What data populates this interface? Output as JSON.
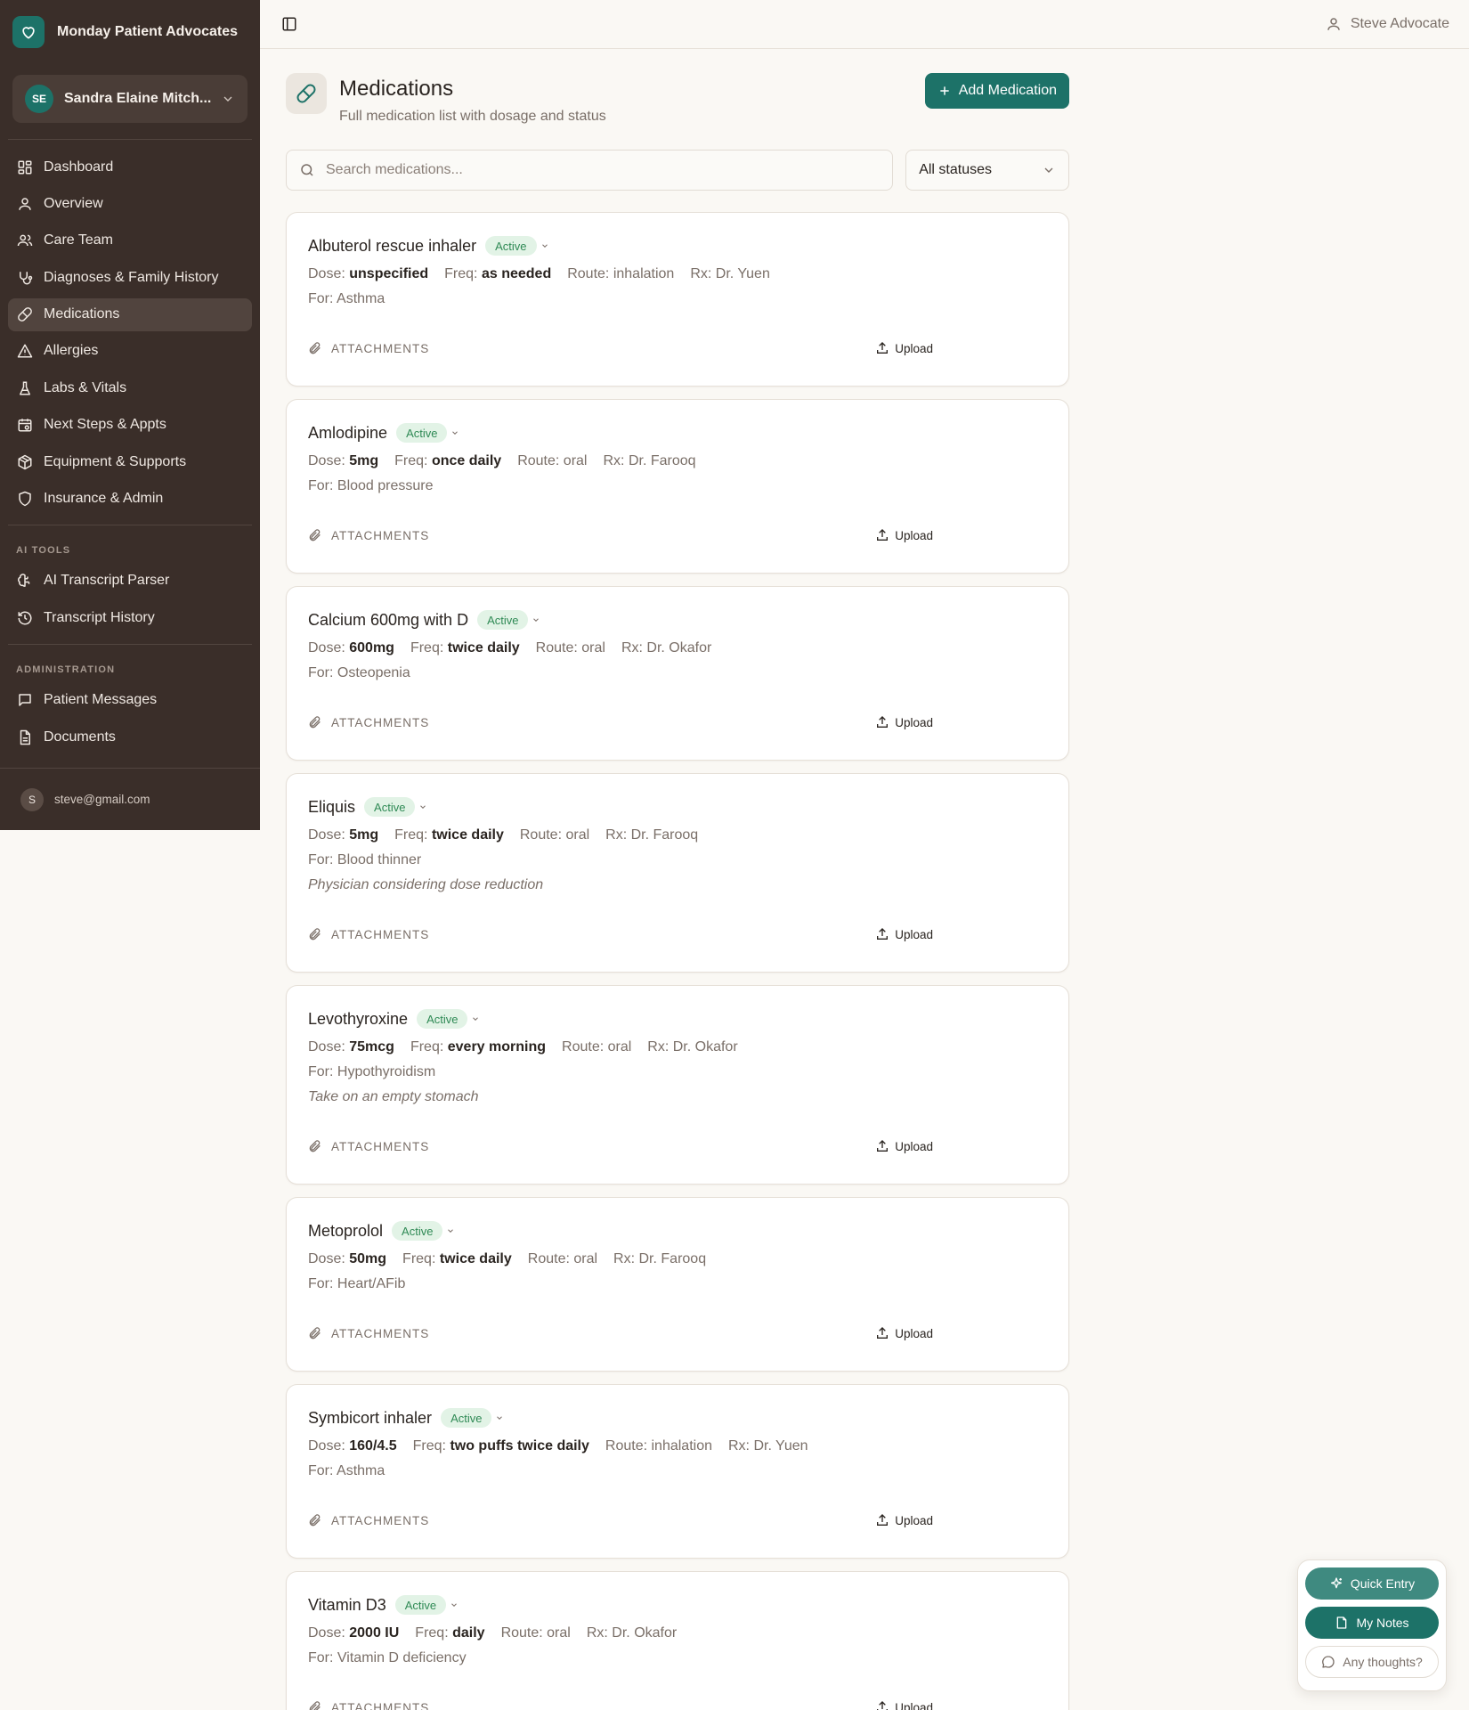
{
  "brand": {
    "name": "Monday Patient Advocates"
  },
  "patient": {
    "initials": "SE",
    "name": "Sandra Elaine Mitch..."
  },
  "nav": {
    "items": [
      {
        "label": "Dashboard",
        "icon": "dashboard-icon"
      },
      {
        "label": "Overview",
        "icon": "user-icon"
      },
      {
        "label": "Care Team",
        "icon": "users-icon"
      },
      {
        "label": "Diagnoses & Family History",
        "icon": "stethoscope-icon"
      },
      {
        "label": "Medications",
        "icon": "pill-icon",
        "active": true
      },
      {
        "label": "Allergies",
        "icon": "warning-icon"
      },
      {
        "label": "Labs & Vitals",
        "icon": "flask-icon"
      },
      {
        "label": "Next Steps & Appts",
        "icon": "calendar-icon"
      },
      {
        "label": "Equipment & Supports",
        "icon": "package-icon"
      },
      {
        "label": "Insurance & Admin",
        "icon": "shield-icon"
      }
    ],
    "ai_section": "AI TOOLS",
    "ai_items": [
      {
        "label": "AI Transcript Parser",
        "icon": "brain-icon"
      },
      {
        "label": "Transcript History",
        "icon": "history-icon"
      }
    ],
    "admin_section": "ADMINISTRATION",
    "admin_items": [
      {
        "label": "Patient Messages",
        "icon": "message-icon"
      },
      {
        "label": "Documents",
        "icon": "document-icon"
      }
    ]
  },
  "footer": {
    "initial": "S",
    "email": "steve@gmail.com"
  },
  "topbar": {
    "user": "Steve Advocate"
  },
  "page": {
    "title": "Medications",
    "subtitle": "Full medication list with dosage and status",
    "add_label": "Add Medication",
    "search_placeholder": "Search medications...",
    "status_filter": "All statuses"
  },
  "labels": {
    "dose": "Dose:",
    "freq": "Freq:",
    "route": "Route:",
    "rx": "Rx:",
    "for": "For:",
    "attachments": "ATTACHMENTS",
    "upload": "Upload"
  },
  "medications": [
    {
      "name": "Albuterol rescue inhaler",
      "status": "Active",
      "dose": "unspecified",
      "freq": "as needed",
      "route": "inhalation",
      "rx": "Dr. Yuen",
      "for": "Asthma",
      "note": ""
    },
    {
      "name": "Amlodipine",
      "status": "Active",
      "dose": "5mg",
      "freq": "once daily",
      "route": "oral",
      "rx": "Dr. Farooq",
      "for": "Blood pressure",
      "note": ""
    },
    {
      "name": "Calcium 600mg with D",
      "status": "Active",
      "dose": "600mg",
      "freq": "twice daily",
      "route": "oral",
      "rx": "Dr. Okafor",
      "for": "Osteopenia",
      "note": ""
    },
    {
      "name": "Eliquis",
      "status": "Active",
      "dose": "5mg",
      "freq": "twice daily",
      "route": "oral",
      "rx": "Dr. Farooq",
      "for": "Blood thinner",
      "note": "Physician considering dose reduction"
    },
    {
      "name": "Levothyroxine",
      "status": "Active",
      "dose": "75mcg",
      "freq": "every morning",
      "route": "oral",
      "rx": "Dr. Okafor",
      "for": "Hypothyroidism",
      "note": "Take on an empty stomach"
    },
    {
      "name": "Metoprolol",
      "status": "Active",
      "dose": "50mg",
      "freq": "twice daily",
      "route": "oral",
      "rx": "Dr. Farooq",
      "for": "Heart/AFib",
      "note": ""
    },
    {
      "name": "Symbicort inhaler",
      "status": "Active",
      "dose": "160/4.5",
      "freq": "two puffs twice daily",
      "route": "inhalation",
      "rx": "Dr. Yuen",
      "for": "Asthma",
      "note": ""
    },
    {
      "name": "Vitamin D3",
      "status": "Active",
      "dose": "2000 IU",
      "freq": "daily",
      "route": "oral",
      "rx": "Dr. Okafor",
      "for": "Vitamin D deficiency",
      "note": ""
    }
  ],
  "widget": {
    "quick_entry": "Quick Entry",
    "my_notes": "My Notes",
    "thoughts": "Any thoughts?"
  },
  "colors": {
    "sidebar": "#3a2e29",
    "accent": "#1d7268",
    "badge_bg": "#e2f3e6",
    "badge_text": "#2f8a55"
  }
}
